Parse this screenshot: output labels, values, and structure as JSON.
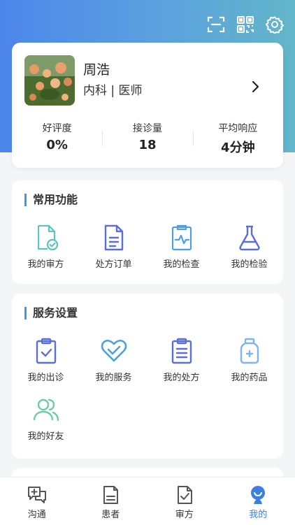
{
  "header": {
    "icons": [
      "scan-icon",
      "qrcode-icon",
      "settings-icon"
    ]
  },
  "profile": {
    "name": "周浩",
    "department_title": "内科 |  医师",
    "stats": [
      {
        "label": "好评度",
        "value": "0%"
      },
      {
        "label": "接诊量",
        "value": "18"
      },
      {
        "label": "平均响应",
        "value": "4分钟"
      }
    ]
  },
  "common": {
    "title": "常用功能",
    "items": [
      {
        "label": "我的审方",
        "icon": "review-icon"
      },
      {
        "label": "处方订单",
        "icon": "document-icon"
      },
      {
        "label": "我的检查",
        "icon": "exam-icon"
      },
      {
        "label": "我的检验",
        "icon": "flask-icon"
      }
    ]
  },
  "service": {
    "title": "服务设置",
    "items": [
      {
        "label": "我的出诊",
        "icon": "clipboard-check-icon"
      },
      {
        "label": "我的服务",
        "icon": "heart-icon"
      },
      {
        "label": "我的处方",
        "icon": "prescription-icon"
      },
      {
        "label": "我的药品",
        "icon": "medicine-bottle-icon"
      },
      {
        "label": "我的好友",
        "icon": "friends-icon"
      }
    ]
  },
  "tabbar": {
    "items": [
      {
        "label": "沟通",
        "icon": "chat-plus-icon"
      },
      {
        "label": "患者",
        "icon": "patient-card-icon"
      },
      {
        "label": "审方",
        "icon": "review-check-icon"
      },
      {
        "label": "我的",
        "icon": "user-icon",
        "active": true
      }
    ]
  },
  "colors": {
    "accent": "#4a8fe8",
    "teal": "#62b6c9",
    "active_tab": "#3d7fe0"
  }
}
